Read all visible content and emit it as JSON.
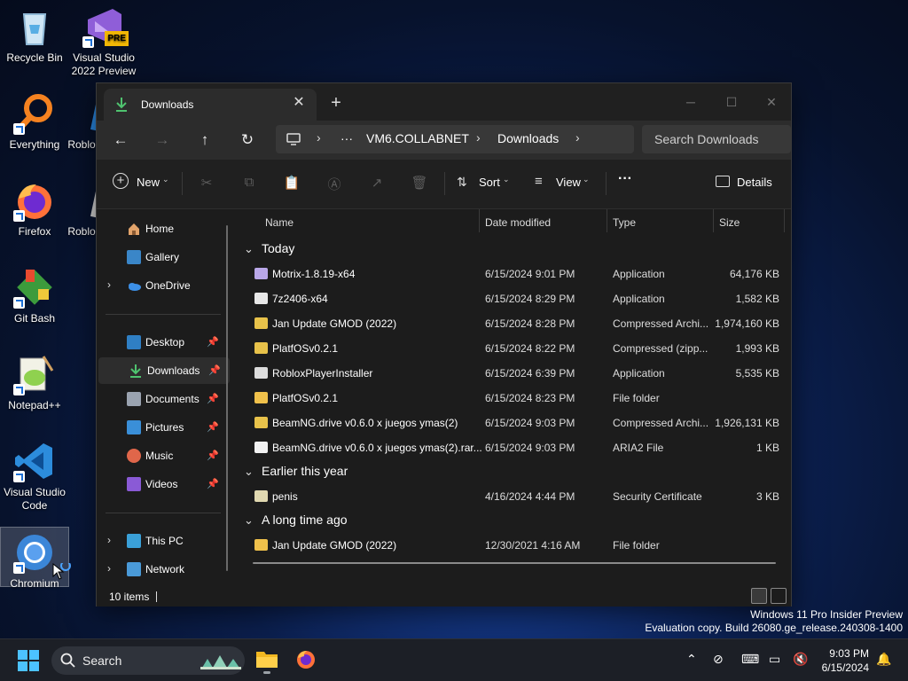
{
  "desktop": {
    "icons": [
      {
        "label": "Recycle Bin",
        "icon": "recycle-bin-icon"
      },
      {
        "label": "Visual Studio 2022 Preview",
        "badge": "PRE",
        "icon": "visual-studio-preview-icon"
      },
      {
        "label": "Everything",
        "icon": "everything-search-icon"
      },
      {
        "label": "Roblo",
        "icon": "roblox-icon"
      },
      {
        "label": "Firefox",
        "icon": "firefox-icon"
      },
      {
        "label": "Roblo",
        "icon": "roblox-studio-icon"
      },
      {
        "label": "Git Bash",
        "icon": "git-bash-icon"
      },
      {
        "label": "Notepad++",
        "icon": "notepad-plus-plus-icon"
      },
      {
        "label": "Visual Studio Code",
        "icon": "vscode-icon"
      },
      {
        "label": "Chromium",
        "icon": "chromium-icon"
      }
    ]
  },
  "window": {
    "tab_title": "Downloads",
    "tab_close": "✕",
    "new_tab": "+",
    "controls": {
      "minimize": "─",
      "maximize": "☐",
      "close": "✕"
    },
    "nav": {
      "back": "←",
      "forward": "→",
      "up": "↑",
      "refresh": "↻"
    },
    "address": {
      "segments": [
        "VM6.COLLABNET",
        "Downloads"
      ],
      "overflow": "···"
    },
    "search_placeholder": "Search Downloads",
    "toolbar": {
      "new_label": "New",
      "sort_label": "Sort",
      "view_label": "View",
      "more_label": "···",
      "details_label": "Details"
    },
    "sidebar": {
      "items": [
        {
          "label": "Home",
          "icon": "home-icon"
        },
        {
          "label": "Gallery",
          "icon": "gallery-icon"
        },
        {
          "label": "OneDrive",
          "icon": "onedrive-icon",
          "expandable": true
        },
        {
          "label": "Desktop",
          "icon": "desktop-folder-icon",
          "pinned": true
        },
        {
          "label": "Downloads",
          "icon": "downloads-folder-icon",
          "pinned": true,
          "active": true
        },
        {
          "label": "Documents",
          "icon": "documents-folder-icon",
          "pinned": true
        },
        {
          "label": "Pictures",
          "icon": "pictures-folder-icon",
          "pinned": true
        },
        {
          "label": "Music",
          "icon": "music-folder-icon",
          "pinned": true
        },
        {
          "label": "Videos",
          "icon": "videos-folder-icon",
          "pinned": true
        },
        {
          "label": "This PC",
          "icon": "this-pc-icon",
          "expandable": true
        },
        {
          "label": "Network",
          "icon": "network-icon",
          "expandable": true
        }
      ]
    },
    "columns": {
      "name": "Name",
      "date": "Date modified",
      "type": "Type",
      "size": "Size"
    },
    "groups": [
      {
        "title": "Today",
        "files": [
          {
            "name": "Motrix-1.8.19-x64",
            "date": "6/15/2024 9:01 PM",
            "type": "Application",
            "size": "64,176 KB",
            "icon": "application-icon",
            "color": "#b9a7e8"
          },
          {
            "name": "7z2406-x64",
            "date": "6/15/2024 8:29 PM",
            "type": "Application",
            "size": "1,582 KB",
            "icon": "7zip-icon",
            "color": "#e8e8e8"
          },
          {
            "name": "Jan Update GMOD (2022)",
            "date": "6/15/2024 8:28 PM",
            "type": "Compressed Archi...",
            "size": "1,974,160 KB",
            "icon": "zip-folder-icon",
            "color": "#e8c24a"
          },
          {
            "name": "PlatfOSv0.2.1",
            "date": "6/15/2024 8:22 PM",
            "type": "Compressed (zipp...",
            "size": "1,993 KB",
            "icon": "zip-folder-icon",
            "color": "#e8c24a"
          },
          {
            "name": "RobloxPlayerInstaller",
            "date": "6/15/2024 6:39 PM",
            "type": "Application",
            "size": "5,535 KB",
            "icon": "roblox-installer-icon",
            "color": "#dcdcdc"
          },
          {
            "name": "PlatfOSv0.2.1",
            "date": "6/15/2024 8:23 PM",
            "type": "File folder",
            "size": "",
            "icon": "folder-icon",
            "color": "#f0c14b"
          },
          {
            "name": "BeamNG.drive v0.6.0 x juegos ymas(2)",
            "date": "6/15/2024 9:03 PM",
            "type": "Compressed Archi...",
            "size": "1,926,131 KB",
            "icon": "zip-folder-icon",
            "color": "#e8c24a"
          },
          {
            "name": "BeamNG.drive v0.6.0 x juegos ymas(2).rar...",
            "date": "6/15/2024 9:03 PM",
            "type": "ARIA2 File",
            "size": "1 KB",
            "icon": "file-icon",
            "color": "#f2f2f2"
          }
        ]
      },
      {
        "title": "Earlier this year",
        "files": [
          {
            "name": "penis",
            "date": "4/16/2024 4:44 PM",
            "type": "Security Certificate",
            "size": "3 KB",
            "icon": "certificate-icon",
            "color": "#e0d8b0"
          }
        ]
      },
      {
        "title": "A long time ago",
        "files": [
          {
            "name": "Jan Update GMOD (2022)",
            "date": "12/30/2021 4:16 AM",
            "type": "File folder",
            "size": "",
            "icon": "folder-icon",
            "color": "#f0c14b"
          }
        ]
      }
    ],
    "status": "10 items"
  },
  "watermark": {
    "line1": "Windows 11 Pro Insider Preview",
    "line2": "Evaluation copy. Build 26080.ge_release.240308-1400"
  },
  "taskbar": {
    "search_label": "Search",
    "time": "9:03 PM",
    "date": "6/15/2024"
  },
  "colors": {
    "accent": "#60cdff",
    "window_bg": "#1c1c1c",
    "taskbar_bg": "#1c1f26"
  }
}
